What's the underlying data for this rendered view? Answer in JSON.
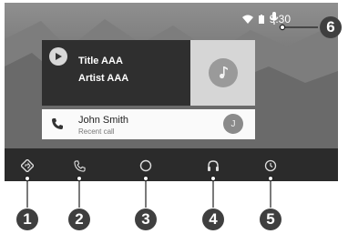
{
  "status": {
    "time": "9:30",
    "wifi_icon": "wifi-icon",
    "battery_icon": "battery-icon",
    "mic_icon": "mic-icon"
  },
  "media": {
    "title": "Title AAA",
    "artist": "Artist AAA",
    "play_icon": "play-icon",
    "art_icon": "music-note-icon"
  },
  "call": {
    "name": "John Smith",
    "subtitle": "Recent call",
    "avatar_letter": "J",
    "phone_icon": "phone-icon"
  },
  "nav": [
    {
      "name": "navigation",
      "icon": "navigation-icon"
    },
    {
      "name": "phone",
      "icon": "phone-icon"
    },
    {
      "name": "home",
      "icon": "home-icon"
    },
    {
      "name": "audio",
      "icon": "headphones-icon"
    },
    {
      "name": "apps",
      "icon": "apps-icon"
    }
  ],
  "callouts": [
    "1",
    "2",
    "3",
    "4",
    "5",
    "6"
  ],
  "colors": {
    "screen": "#6e6e6e",
    "navbar": "#2b2b2b",
    "media_card": "#2f2f2f",
    "callout": "#3f3f3f"
  }
}
